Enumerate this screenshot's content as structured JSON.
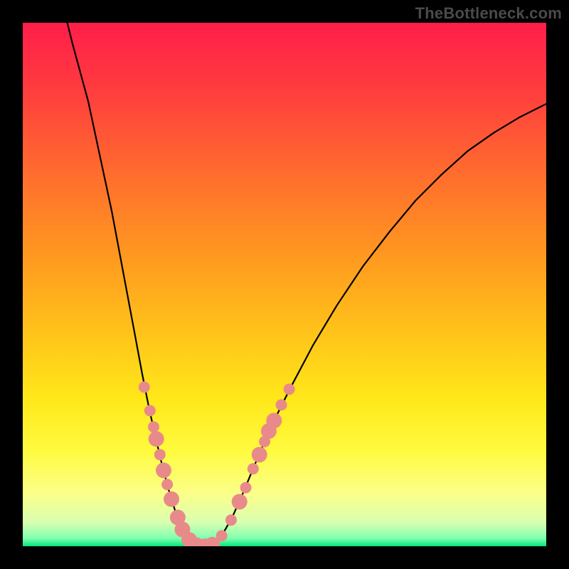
{
  "watermark": "TheBottleneck.com",
  "gradient": {
    "stops": [
      {
        "offset": 0.0,
        "color": "#ff1e4a"
      },
      {
        "offset": 0.12,
        "color": "#ff3a3f"
      },
      {
        "offset": 0.28,
        "color": "#ff6a2f"
      },
      {
        "offset": 0.45,
        "color": "#ff9a1f"
      },
      {
        "offset": 0.6,
        "color": "#ffc51a"
      },
      {
        "offset": 0.72,
        "color": "#ffe81a"
      },
      {
        "offset": 0.82,
        "color": "#fffb40"
      },
      {
        "offset": 0.9,
        "color": "#fbff8a"
      },
      {
        "offset": 0.955,
        "color": "#d9ffb0"
      },
      {
        "offset": 0.985,
        "color": "#7fffb0"
      },
      {
        "offset": 1.0,
        "color": "#00e878"
      }
    ]
  },
  "curve": {
    "color": "#000000",
    "width": 2.2,
    "points": [
      {
        "x": 0.085,
        "y": 1.0
      },
      {
        "x": 0.095,
        "y": 0.96
      },
      {
        "x": 0.11,
        "y": 0.905
      },
      {
        "x": 0.125,
        "y": 0.85
      },
      {
        "x": 0.14,
        "y": 0.78
      },
      {
        "x": 0.155,
        "y": 0.71
      },
      {
        "x": 0.17,
        "y": 0.64
      },
      {
        "x": 0.185,
        "y": 0.56
      },
      {
        "x": 0.2,
        "y": 0.48
      },
      {
        "x": 0.215,
        "y": 0.4
      },
      {
        "x": 0.228,
        "y": 0.33
      },
      {
        "x": 0.24,
        "y": 0.27
      },
      {
        "x": 0.252,
        "y": 0.215
      },
      {
        "x": 0.265,
        "y": 0.16
      },
      {
        "x": 0.278,
        "y": 0.11
      },
      {
        "x": 0.292,
        "y": 0.065
      },
      {
        "x": 0.305,
        "y": 0.03
      },
      {
        "x": 0.32,
        "y": 0.01
      },
      {
        "x": 0.335,
        "y": 0.0
      },
      {
        "x": 0.35,
        "y": 0.0
      },
      {
        "x": 0.365,
        "y": 0.005
      },
      {
        "x": 0.38,
        "y": 0.02
      },
      {
        "x": 0.4,
        "y": 0.055
      },
      {
        "x": 0.42,
        "y": 0.1
      },
      {
        "x": 0.445,
        "y": 0.16
      },
      {
        "x": 0.475,
        "y": 0.23
      },
      {
        "x": 0.51,
        "y": 0.3
      },
      {
        "x": 0.555,
        "y": 0.385
      },
      {
        "x": 0.6,
        "y": 0.46
      },
      {
        "x": 0.65,
        "y": 0.535
      },
      {
        "x": 0.7,
        "y": 0.6
      },
      {
        "x": 0.75,
        "y": 0.66
      },
      {
        "x": 0.8,
        "y": 0.71
      },
      {
        "x": 0.85,
        "y": 0.755
      },
      {
        "x": 0.9,
        "y": 0.79
      },
      {
        "x": 0.95,
        "y": 0.82
      },
      {
        "x": 1.0,
        "y": 0.845
      }
    ]
  },
  "markers": {
    "radius_small": 8,
    "radius_large": 11,
    "fill": "#e98a8a",
    "points": [
      {
        "x": 0.232,
        "y": 0.304,
        "r": 8
      },
      {
        "x": 0.243,
        "y": 0.259,
        "r": 8
      },
      {
        "x": 0.25,
        "y": 0.228,
        "r": 8
      },
      {
        "x": 0.255,
        "y": 0.205,
        "r": 11
      },
      {
        "x": 0.262,
        "y": 0.175,
        "r": 8
      },
      {
        "x": 0.269,
        "y": 0.145,
        "r": 11
      },
      {
        "x": 0.276,
        "y": 0.118,
        "r": 8
      },
      {
        "x": 0.284,
        "y": 0.09,
        "r": 11
      },
      {
        "x": 0.296,
        "y": 0.055,
        "r": 11
      },
      {
        "x": 0.305,
        "y": 0.032,
        "r": 11
      },
      {
        "x": 0.318,
        "y": 0.012,
        "r": 11
      },
      {
        "x": 0.332,
        "y": 0.002,
        "r": 11
      },
      {
        "x": 0.348,
        "y": 0.0,
        "r": 11
      },
      {
        "x": 0.362,
        "y": 0.003,
        "r": 11
      },
      {
        "x": 0.38,
        "y": 0.02,
        "r": 8
      },
      {
        "x": 0.398,
        "y": 0.05,
        "r": 8
      },
      {
        "x": 0.414,
        "y": 0.085,
        "r": 11
      },
      {
        "x": 0.426,
        "y": 0.112,
        "r": 8
      },
      {
        "x": 0.44,
        "y": 0.148,
        "r": 8
      },
      {
        "x": 0.452,
        "y": 0.175,
        "r": 11
      },
      {
        "x": 0.462,
        "y": 0.2,
        "r": 8
      },
      {
        "x": 0.47,
        "y": 0.22,
        "r": 11
      },
      {
        "x": 0.48,
        "y": 0.24,
        "r": 11
      },
      {
        "x": 0.494,
        "y": 0.27,
        "r": 8
      },
      {
        "x": 0.509,
        "y": 0.3,
        "r": 8
      }
    ]
  },
  "chart_data": {
    "type": "line",
    "title": "",
    "xlabel": "",
    "ylabel": "",
    "xlim": [
      0,
      1
    ],
    "ylim": [
      0,
      1
    ],
    "legend": false,
    "grid": false,
    "annotations": [
      "TheBottleneck.com"
    ],
    "series": [
      {
        "name": "bottleneck-curve",
        "color": "#000000",
        "x": [
          0.085,
          0.095,
          0.11,
          0.125,
          0.14,
          0.155,
          0.17,
          0.185,
          0.2,
          0.215,
          0.228,
          0.24,
          0.252,
          0.265,
          0.278,
          0.292,
          0.305,
          0.32,
          0.335,
          0.35,
          0.365,
          0.38,
          0.4,
          0.42,
          0.445,
          0.475,
          0.51,
          0.555,
          0.6,
          0.65,
          0.7,
          0.75,
          0.8,
          0.85,
          0.9,
          0.95,
          1.0
        ],
        "y": [
          1.0,
          0.96,
          0.905,
          0.85,
          0.78,
          0.71,
          0.64,
          0.56,
          0.48,
          0.4,
          0.33,
          0.27,
          0.215,
          0.16,
          0.11,
          0.065,
          0.03,
          0.01,
          0.0,
          0.0,
          0.005,
          0.02,
          0.055,
          0.1,
          0.16,
          0.23,
          0.3,
          0.385,
          0.46,
          0.535,
          0.6,
          0.66,
          0.71,
          0.755,
          0.79,
          0.82,
          0.845
        ]
      },
      {
        "name": "markers",
        "type": "scatter",
        "color": "#e98a8a",
        "x": [
          0.232,
          0.243,
          0.25,
          0.255,
          0.262,
          0.269,
          0.276,
          0.284,
          0.296,
          0.305,
          0.318,
          0.332,
          0.348,
          0.362,
          0.38,
          0.398,
          0.414,
          0.426,
          0.44,
          0.452,
          0.462,
          0.47,
          0.48,
          0.494,
          0.509
        ],
        "y": [
          0.304,
          0.259,
          0.228,
          0.205,
          0.175,
          0.145,
          0.118,
          0.09,
          0.055,
          0.032,
          0.012,
          0.002,
          0.0,
          0.003,
          0.02,
          0.05,
          0.085,
          0.112,
          0.148,
          0.175,
          0.2,
          0.22,
          0.24,
          0.27,
          0.3
        ]
      }
    ],
    "background_gradient": {
      "direction": "vertical",
      "stops": [
        {
          "offset": 0.0,
          "color": "#ff1e4a"
        },
        {
          "offset": 0.45,
          "color": "#ff9a1f"
        },
        {
          "offset": 0.72,
          "color": "#ffe81a"
        },
        {
          "offset": 0.955,
          "color": "#d9ffb0"
        },
        {
          "offset": 1.0,
          "color": "#00e878"
        }
      ]
    }
  }
}
